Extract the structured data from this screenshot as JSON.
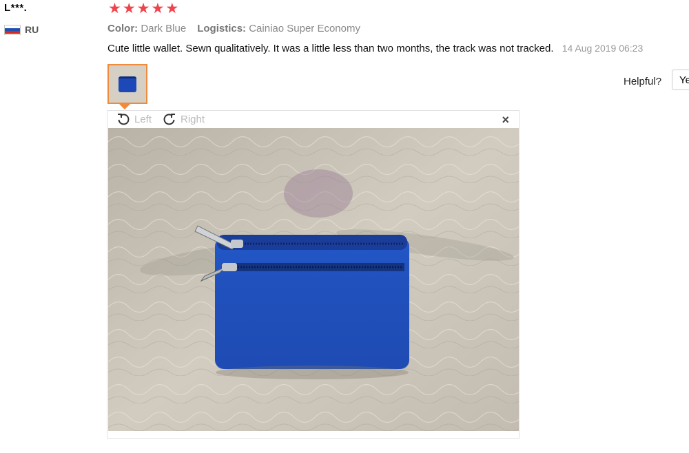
{
  "reviewer": {
    "name": "L***.",
    "country_code": "RU",
    "flag_colors": [
      "#ffffff",
      "#1f4fb0",
      "#d52b1e"
    ]
  },
  "rating": {
    "stars": 5,
    "max": 5,
    "color": "#f0444d"
  },
  "attributes": {
    "color_label": "Color:",
    "color_value": "Dark Blue",
    "logistics_label": "Logistics:",
    "logistics_value": "Cainiao Super Economy"
  },
  "review": {
    "text": "Cute little wallet. Sewn qualitatively. It was a little less than two months, the track was not tracked.",
    "date": "14 Aug 2019 06:23"
  },
  "helpful": {
    "label": "Helpful?",
    "yes_label": "Ye"
  },
  "viewer": {
    "rotate_left_label": "Left",
    "rotate_right_label": "Right",
    "close_label": "×",
    "accent_color": "#f08a3c"
  }
}
